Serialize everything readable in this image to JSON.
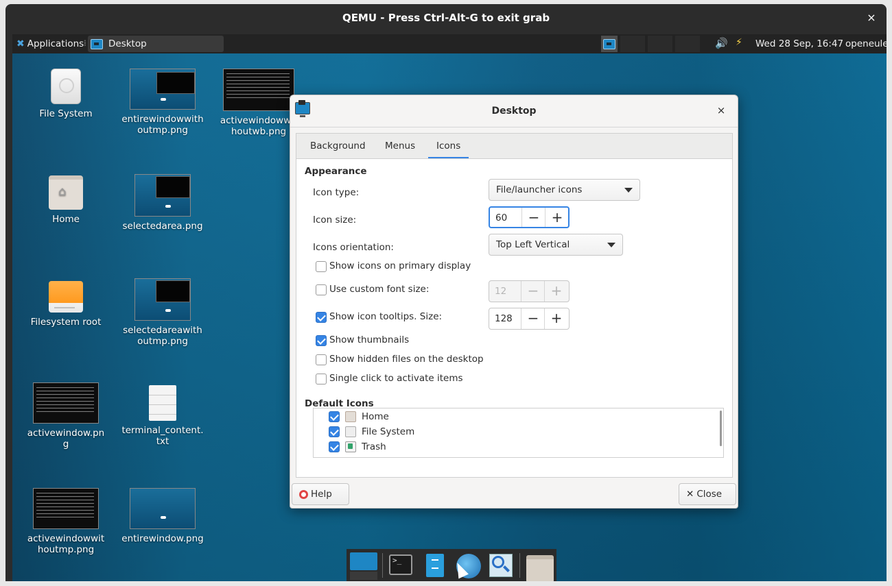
{
  "qemu": {
    "title": "QEMU - Press Ctrl-Alt-G to exit grab",
    "close": "×"
  },
  "panel": {
    "applications": "Applications",
    "task": "Desktop",
    "clock": "Wed 28 Sep, 16:47",
    "user": "openeuler",
    "volume_glyph": "🔊",
    "network_glyph": "⚡"
  },
  "desktop_icons": [
    {
      "label": "File System",
      "icon": "hard-drive-icon"
    },
    {
      "label": "entirewindowwithoutmp.png",
      "icon": "screenshot-thumbnail"
    },
    {
      "label": "activewindowwithoutwb.png",
      "icon": "terminal-thumbnail"
    },
    {
      "label": "Home",
      "icon": "home-folder-icon"
    },
    {
      "label": "selectedarea.png",
      "icon": "screenshot-thumbnail"
    },
    {
      "label": "Filesystem root",
      "icon": "drive-icon"
    },
    {
      "label": "selectedareawithoutmp.png",
      "icon": "screenshot-thumbnail"
    },
    {
      "label": "activewindow.png",
      "icon": "terminal-thumbnail"
    },
    {
      "label": "terminal_content.txt",
      "icon": "text-file-icon"
    },
    {
      "label": "activewindowwithoutmp.png",
      "icon": "terminal-thumbnail"
    },
    {
      "label": "entirewindow.png",
      "icon": "screenshot-thumbnail"
    }
  ],
  "dialog": {
    "title": "Desktop",
    "close": "×",
    "tabs": [
      "Background",
      "Menus",
      "Icons"
    ],
    "active_tab": "Icons",
    "appearance": {
      "heading": "Appearance",
      "icon_type_label": "Icon type:",
      "icon_type_value": "File/launcher icons",
      "icon_size_label": "Icon size:",
      "icon_size_value": "60",
      "orientation_label": "Icons orientation:",
      "orientation_value": "Top Left Vertical",
      "show_primary": "Show icons on primary display",
      "custom_font": "Use custom font size:",
      "custom_font_value": "12",
      "tooltips": "Show icon tooltips. Size:",
      "tooltips_value": "128",
      "thumbnails": "Show thumbnails",
      "hidden": "Show hidden files on the desktop",
      "single_click": "Single click to activate items"
    },
    "checks": {
      "show_primary": false,
      "custom_font": false,
      "tooltips": true,
      "thumbnails": true,
      "hidden": false,
      "single_click": false
    },
    "default_icons": {
      "heading": "Default Icons",
      "items": [
        {
          "label": "Home",
          "checked": true
        },
        {
          "label": "File System",
          "checked": true
        },
        {
          "label": "Trash",
          "checked": true
        }
      ]
    },
    "spin_minus": "−",
    "spin_plus": "+",
    "help_button": "Help",
    "close_button": "Close",
    "close_button_glyph": "✕"
  },
  "colors": {
    "accent": "#3584e4",
    "panel": "#232323",
    "desktop": "#0f6d98"
  }
}
